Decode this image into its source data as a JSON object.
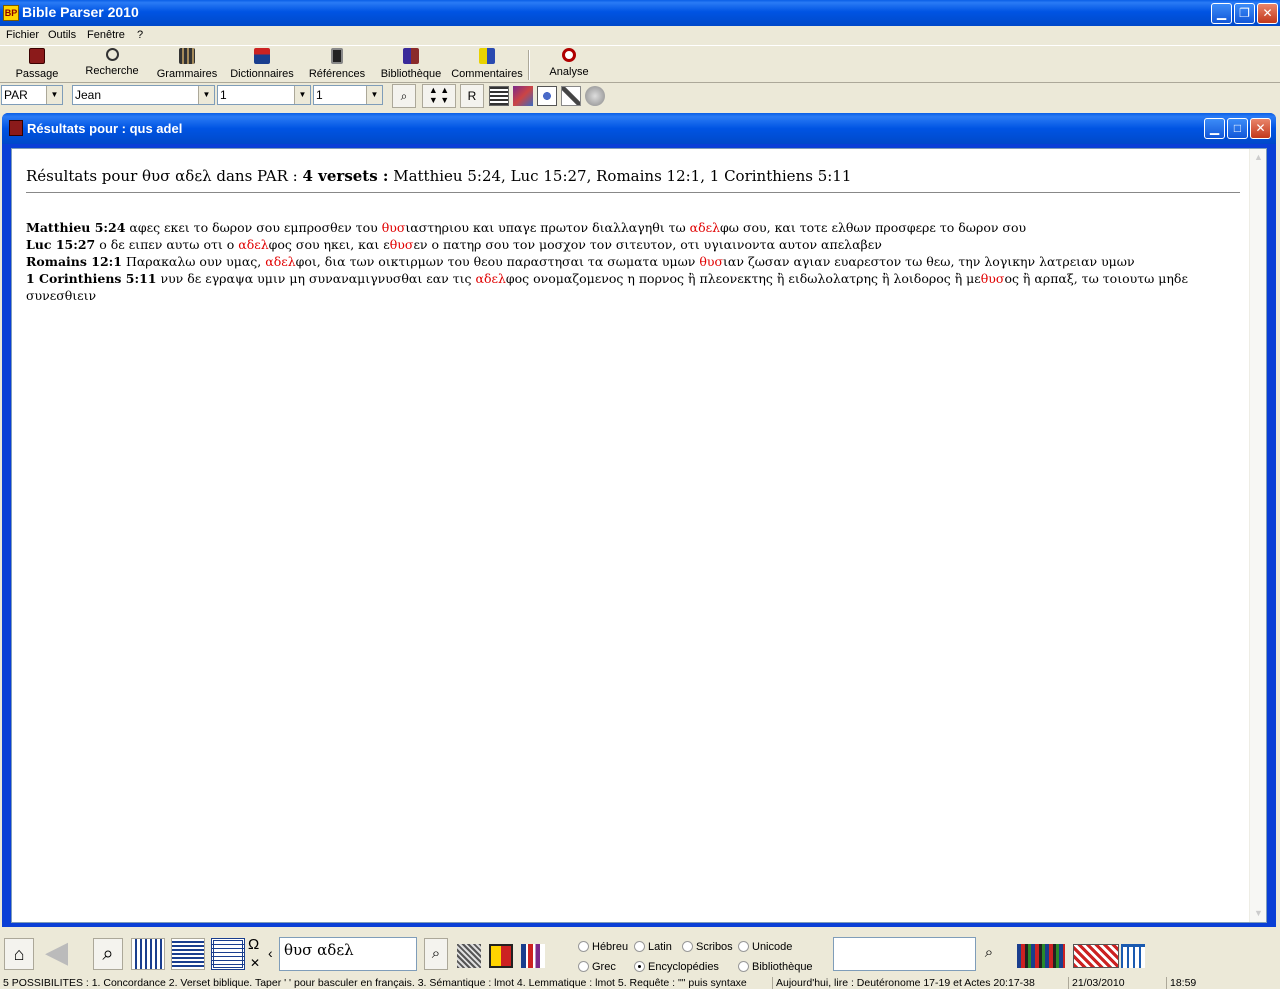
{
  "app": {
    "title": "Bible Parser 2010",
    "icon_text": "BP"
  },
  "menu": [
    "Fichier",
    "Outils",
    "Fenêtre",
    "?"
  ],
  "toolbar": {
    "passage": "Passage",
    "recherche": "Recherche",
    "grammaires": "Grammaires",
    "dictionnaires": "Dictionnaires",
    "references": "Références",
    "bibliotheque": "Bibliothèque",
    "commentaires": "Commentaires",
    "analyse": "Analyse"
  },
  "selectors": {
    "version": "PAR",
    "book": "Jean",
    "chapter": "1",
    "verse": "1",
    "r_label": "R"
  },
  "results_window": {
    "title": "Résultats pour : qus adel",
    "headline_prefix": "Résultats pour θυσ αδελ dans PAR : ",
    "headline_count": "4 versets :",
    "headline_refs": " Matthieu 5:24, Luc 15:27, Romains 12:1, 1 Corinthiens 5:11",
    "verses": [
      {
        "ref": "Matthieu 5:24",
        "parts": [
          " αφες εκει το δωρον σου εμπροσθεν του ",
          "θυσ",
          "ιαστηριου και υπαγε πρωτον διαλλαγηθι τω ",
          "αδελ",
          "φω σου, και τοτε ελθων προσφερε το δωρον σου"
        ]
      },
      {
        "ref": "Luc 15:27",
        "parts": [
          " ο δε ειπεν αυτω οτι ο ",
          "αδελ",
          "φος σου ηκει, και ε",
          "θυσ",
          "εν ο πατηρ σου τον μοσχον τον σιτευτον, οτι υγιαινοντα αυτον απελαβεν"
        ]
      },
      {
        "ref": "Romains 12:1",
        "parts": [
          " Παρακαλω ουν υμας, ",
          "αδελ",
          "φοι, δια των οικτιρμων του θεου παραστησαι τα σωματα υμων ",
          "θυσ",
          "ιαν ζωσαν αγιαν ευαρεστον τω θεω, την λογικην λατρειαν υμων"
        ]
      },
      {
        "ref": "1 Corinthiens 5:11",
        "parts": [
          " νυν δε εγραψα υμιν μη συναναμιγνυσθαι εαν τις ",
          "αδελ",
          "φος ονομαζομενος η πορνος ἢ πλεονεκτης ἢ ειδωλολατρης ἢ λοιδορος ἢ με",
          "θυσ",
          "ος ἢ αρπαξ, τω τοιουτω μηδε συνεσθιειν"
        ]
      }
    ]
  },
  "bottom": {
    "omega": "Ω",
    "chevron": "‹",
    "search_value": "θυσ αδελ",
    "radios": {
      "hebreu": "Hébreu",
      "latin": "Latin",
      "scribos": "Scribos",
      "unicode": "Unicode",
      "grec": "Grec",
      "encyclopedies": "Encyclopédies",
      "bibliotheque": "Bibliothèque"
    },
    "selected_radio": "encyclopedies"
  },
  "status": {
    "help": "5 POSSIBILITES : 1. Concordance 2. Verset biblique. Taper ' ' pour basculer en français. 3. Sémantique : lmot 4. Lemmatique : lmot 5. Requête : \"\" puis syntaxe",
    "reading": "Aujourd'hui, lire : Deutéronome 17-19 et Actes 20:17-38",
    "date": "21/03/2010",
    "time": "18:59"
  },
  "colors": {
    "highlight": "#E00000",
    "xp_blue": "#0054E3"
  }
}
